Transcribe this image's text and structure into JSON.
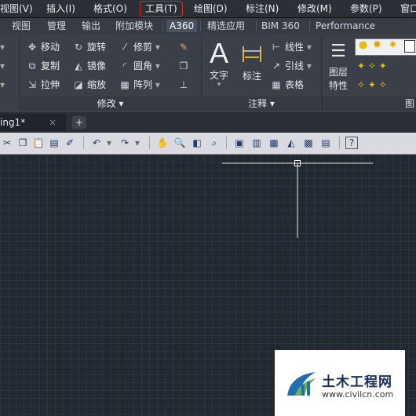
{
  "menu": {
    "items": [
      "视图(V)",
      "插入(I)",
      "格式(O)",
      "工具(T)",
      "绘图(D)",
      "标注(N)",
      "修改(M)",
      "参数(P)",
      "窗口"
    ]
  },
  "ribbon_tabs": [
    "视图",
    "管理",
    "输出",
    "附加模块",
    "A360",
    "精选应用",
    "BIM 360",
    "Performance"
  ],
  "ribbon": {
    "modify": {
      "move": "移动",
      "rotate": "旋转",
      "trim": "修剪",
      "copy": "复制",
      "mirror": "镜像",
      "fillet": "圆角",
      "stretch": "拉伸",
      "scale": "缩放",
      "array": "阵列",
      "footer": "修改"
    },
    "annotation": {
      "text": "文字",
      "dimension": "标注",
      "linear": "线性",
      "leader": "引线",
      "table": "表格",
      "footer": "注释"
    },
    "layers": {
      "layer_props_line1": "图层",
      "layer_props_line2": "特性",
      "footer": "图"
    }
  },
  "document": {
    "tab_label": "ing1*",
    "close": "×",
    "new_tab": "+"
  },
  "watermark": {
    "brand": "土木工程网",
    "url": "www.civilcn.com"
  },
  "colors": {
    "highlight_box": "#e0262b",
    "canvas_bg": "#212830",
    "brand_blue": "#1f6fb5"
  }
}
